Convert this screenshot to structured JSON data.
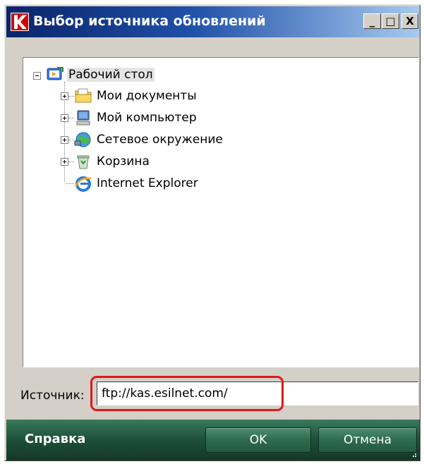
{
  "window": {
    "title": "Выбор источника обновлений",
    "minimize_glyph": "_",
    "maximize_glyph": "□",
    "close_glyph": "X"
  },
  "tree": {
    "root": {
      "label": "Рабочий стол",
      "icon": "desktop-icon",
      "expanded": true
    },
    "items": [
      {
        "label": "Мои документы",
        "icon": "my-documents-icon",
        "expandable": true
      },
      {
        "label": "Мой компьютер",
        "icon": "my-computer-icon",
        "expandable": true
      },
      {
        "label": "Сетевое окружение",
        "icon": "network-places-icon",
        "expandable": true
      },
      {
        "label": "Корзина",
        "icon": "recycle-bin-icon",
        "expandable": true
      },
      {
        "label": "Internet Explorer",
        "icon": "internet-explorer-icon",
        "expandable": false
      }
    ]
  },
  "source": {
    "label": "Источник:",
    "value": "ftp://kas.esilnet.com/"
  },
  "footer": {
    "help_label": "Справка",
    "ok_label": "OK",
    "cancel_label": "Отмена"
  },
  "colors": {
    "titlebar_start": "#0a246a",
    "titlebar_end": "#a6caf0",
    "footer_green": "#1d4f3a",
    "highlight_red": "#e01818"
  }
}
